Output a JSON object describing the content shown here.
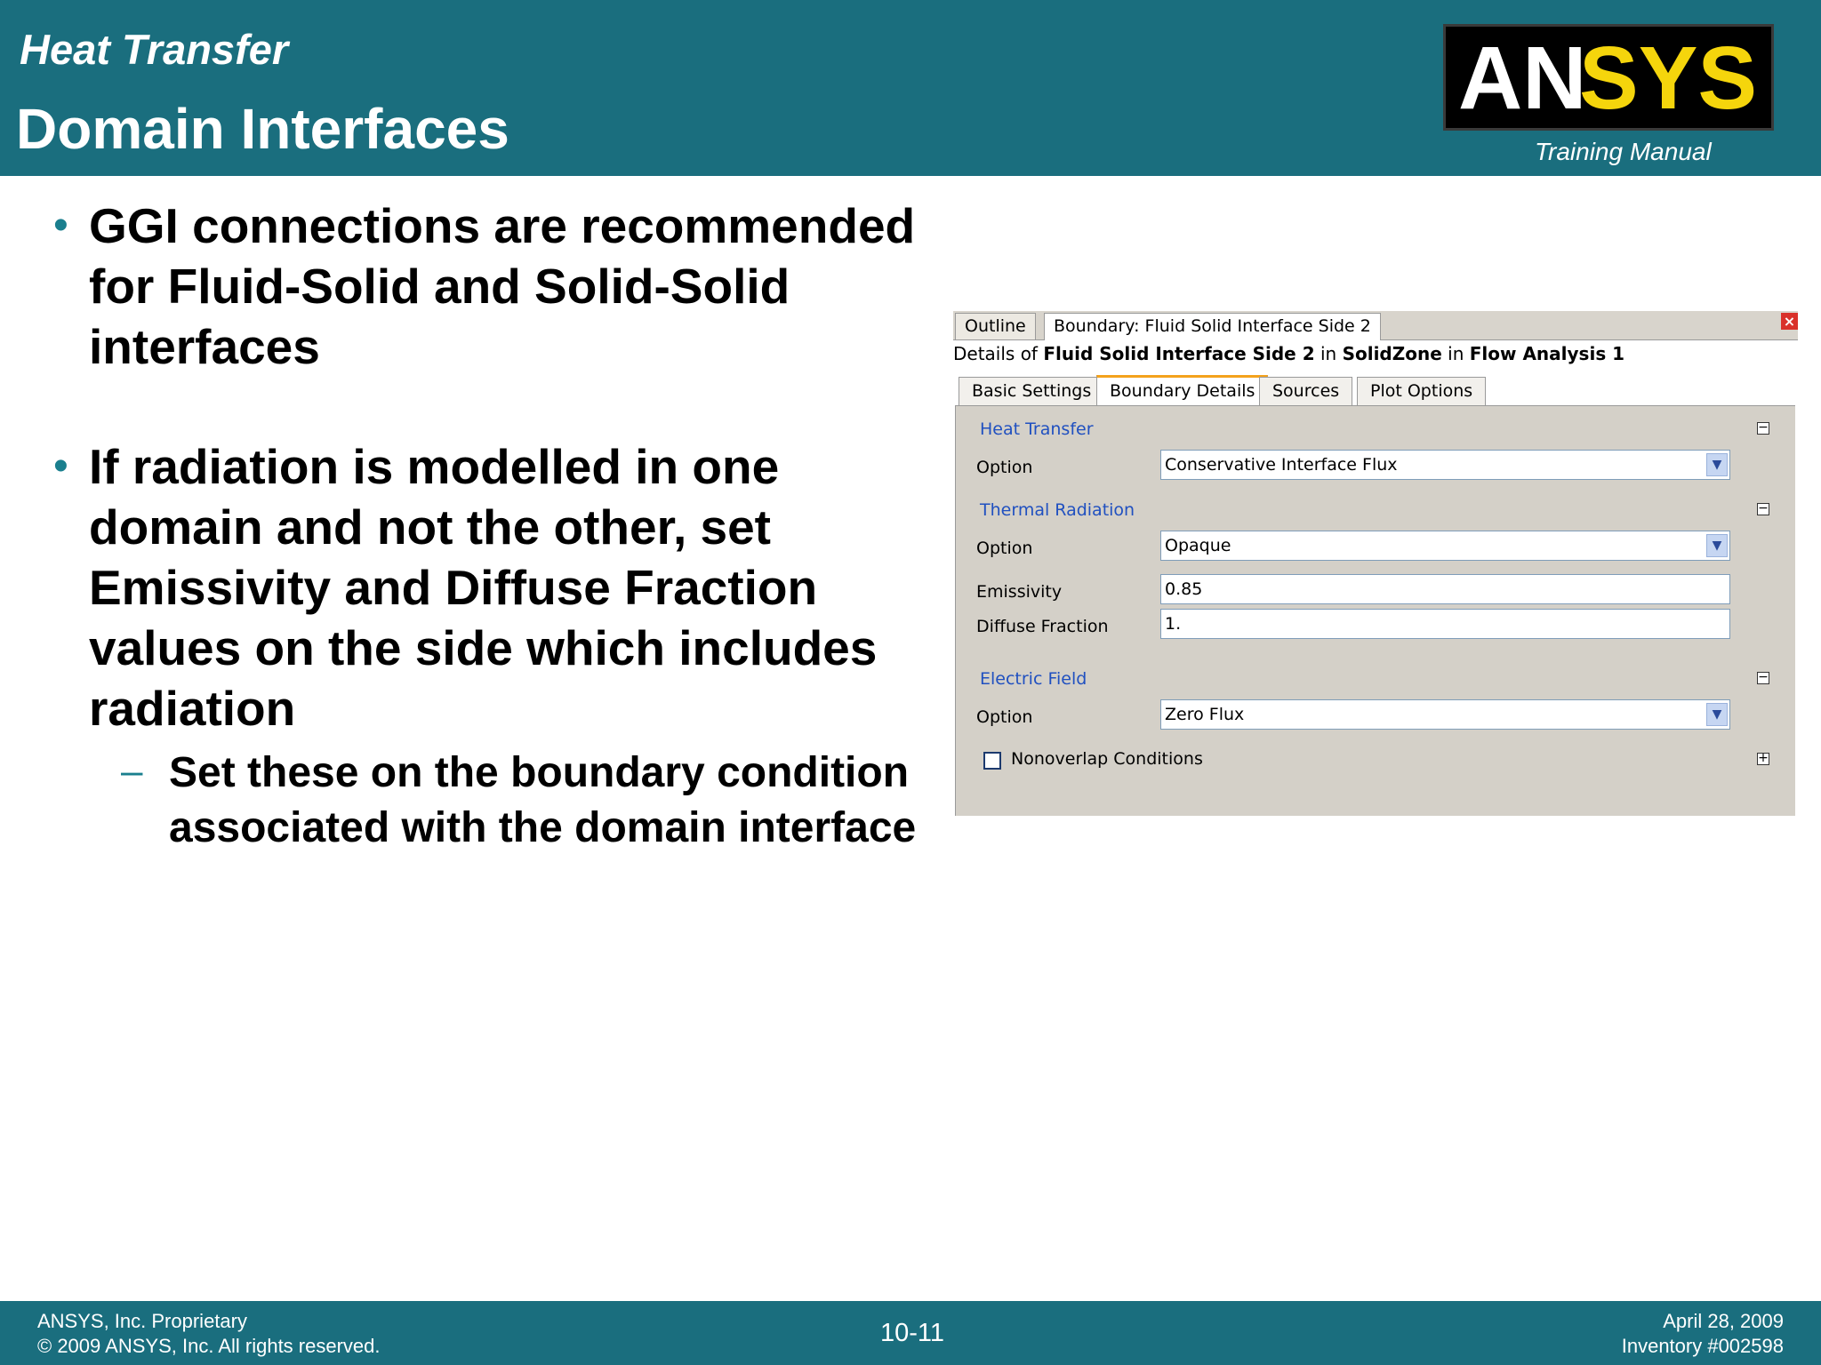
{
  "header": {
    "course": "Heat Transfer",
    "title": "Domain Interfaces",
    "logo_text_white": "AN",
    "logo_text_yellow": "SYS",
    "manual": "Training Manual"
  },
  "bullets": [
    {
      "text": "GGI connections are recommended for Fluid-Solid and Solid-Solid interfaces"
    },
    {
      "text": "If radiation is modelled in one domain and not the other, set Emissivity and Diffuse Fraction values on the side which includes radiation"
    }
  ],
  "sub_bullet": "Set these on the boundary condition associated with the domain interface",
  "panel": {
    "top_tabs": [
      "Outline",
      "Boundary: Fluid Solid Interface Side 2"
    ],
    "close": "×",
    "details": {
      "prefix": "Details of ",
      "object": "Fluid Solid Interface Side 2",
      "in1": " in ",
      "zone": "SolidZone",
      "in2": " in ",
      "analysis": "Flow Analysis 1"
    },
    "sub_tabs": [
      "Basic Settings",
      "Boundary Details",
      "Sources",
      "Plot Options"
    ],
    "active_sub_tab": "Boundary Details",
    "heat_transfer": {
      "label": "Heat Transfer",
      "option_label": "Option",
      "option_value": "Conservative Interface Flux"
    },
    "thermal_radiation": {
      "label": "Thermal Radiation",
      "option_label": "Option",
      "option_value": "Opaque",
      "emissivity_label": "Emissivity",
      "emissivity_value": "0.85",
      "diffuse_label": "Diffuse Fraction",
      "diffuse_value": "1."
    },
    "electric_field": {
      "label": "Electric Field",
      "option_label": "Option",
      "option_value": "Zero Flux"
    },
    "nonoverlap": {
      "label": "Nonoverlap Conditions",
      "checked": false
    }
  },
  "footer": {
    "left_line1": "ANSYS, Inc. Proprietary",
    "left_line2": "© 2009 ANSYS, Inc.  All rights reserved.",
    "page": "10-11",
    "right_line1": "April 28, 2009",
    "right_line2": "Inventory #002598"
  },
  "colors": {
    "brand_teal": "#1a6e7e",
    "logo_yellow": "#f5d50c",
    "section_blue": "#2050c0"
  }
}
